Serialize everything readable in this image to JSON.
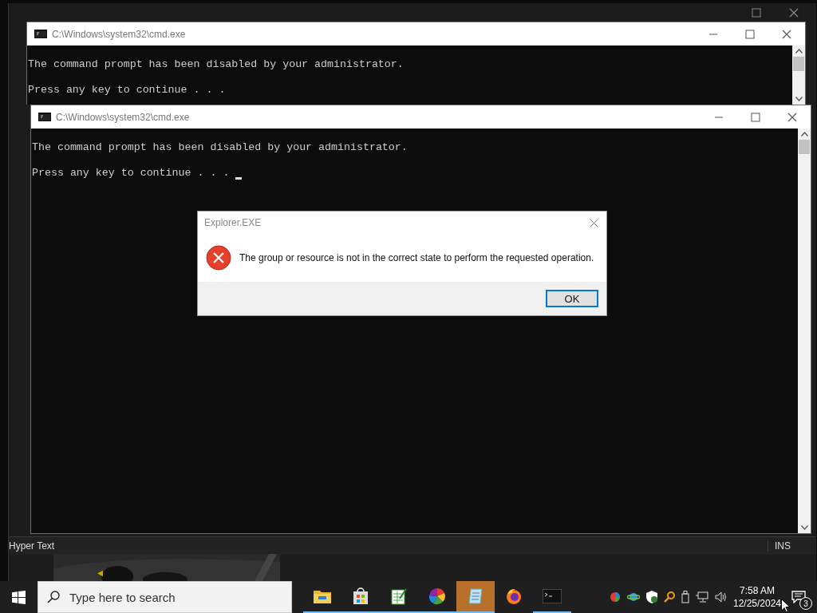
{
  "background_window": {
    "status_left": "Hyper Text",
    "status_right": "INS"
  },
  "cmd_windows": [
    {
      "title": "C:\\Windows\\system32\\cmd.exe",
      "lines": [
        "The command prompt has been disabled by your administrator.",
        "Press any key to continue . . ."
      ]
    },
    {
      "title": "C:\\Windows\\system32\\cmd.exe",
      "lines": [
        "The command prompt has been disabled by your administrator.",
        "Press any key to continue . . ."
      ],
      "cursor": true
    }
  ],
  "dialog": {
    "title": "Explorer.EXE",
    "kind": "error",
    "message": "The group or resource is not in the correct state to perform the requested operation.",
    "buttons": [
      {
        "label": "OK",
        "default": true
      }
    ]
  },
  "taskbar": {
    "search": {
      "placeholder": "Type here to search"
    },
    "apps": [
      {
        "kind": "folder",
        "running": true,
        "selected": false
      },
      {
        "kind": "store",
        "running": true,
        "selected": false
      },
      {
        "kind": "sheet",
        "running": true,
        "selected": false
      },
      {
        "kind": "wheel",
        "running": true,
        "selected": false
      },
      {
        "kind": "notepad",
        "running": true,
        "selected": true
      },
      {
        "kind": "firefox",
        "running": false,
        "selected": false
      },
      {
        "kind": "terminal",
        "running": true,
        "selected": false
      }
    ],
    "clock": {
      "time": "7:58 AM",
      "date": "12/25/2024"
    },
    "notifications": "3"
  }
}
